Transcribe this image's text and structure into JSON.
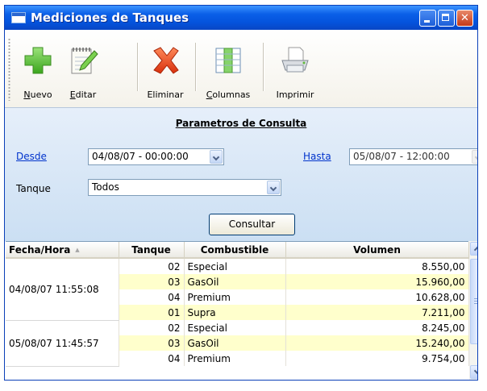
{
  "window": {
    "title": "Mediciones de Tanques"
  },
  "toolbar": {
    "items": [
      {
        "label": "Nuevo",
        "icon": "plus-icon"
      },
      {
        "label": "Editar",
        "icon": "notepad-pencil-icon"
      },
      {
        "label": "Eliminar",
        "icon": "x-delete-icon"
      },
      {
        "label": "Columnas",
        "icon": "columns-icon"
      },
      {
        "label": "Imprimir",
        "icon": "printer-icon"
      }
    ]
  },
  "params": {
    "title": "Parametros de Consulta",
    "desde_label": "Desde",
    "desde_value": "04/08/07 - 00:00:00",
    "hasta_label": "Hasta",
    "hasta_value": "05/08/07 - 12:00:00",
    "tanque_label": "Tanque",
    "tanque_value": "Todos",
    "consultar_label": "Consultar"
  },
  "grid": {
    "columns": [
      "Fecha/Hora",
      "Tanque",
      "Combustible",
      "Volumen"
    ],
    "groups": [
      {
        "fecha": "04/08/07 11:55:08",
        "rows": [
          {
            "tanque": "02",
            "combustible": "Especial",
            "volumen": "8.550,00"
          },
          {
            "tanque": "03",
            "combustible": "GasOil",
            "volumen": "15.960,00"
          },
          {
            "tanque": "04",
            "combustible": "Premium",
            "volumen": "10.628,00"
          },
          {
            "tanque": "01",
            "combustible": "Supra",
            "volumen": "7.211,00"
          }
        ]
      },
      {
        "fecha": "05/08/07 11:45:57",
        "rows": [
          {
            "tanque": "02",
            "combustible": "Especial",
            "volumen": "8.245,00"
          },
          {
            "tanque": "03",
            "combustible": "GasOil",
            "volumen": "15.240,00"
          },
          {
            "tanque": "04",
            "combustible": "Premium",
            "volumen": "9.754,00"
          }
        ]
      }
    ]
  },
  "colors": {
    "titlebar": "#0453dc",
    "params_bg": "#d8e6f6",
    "row_alt": "#ffffcc",
    "link": "#0033cc"
  }
}
